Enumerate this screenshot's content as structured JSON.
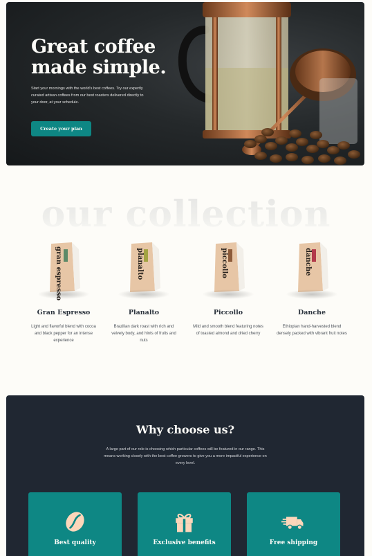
{
  "hero": {
    "title_line1": "Great coffee",
    "title_line2": "made simple.",
    "description": "Start your mornings with the world's best coffees. Try our expertly curated artisan coffees from our best roasters delivered directly to your door, at your schedule.",
    "cta_label": "Create your plan"
  },
  "collection": {
    "heading": "our collection",
    "products": [
      {
        "name": "Gran Espresso",
        "bag_label": "gran espresso",
        "accent": "#5d8a68",
        "description": "Light and flavorful blend with cocoa and black pepper for an intense experience"
      },
      {
        "name": "Planalto",
        "bag_label": "planalto",
        "accent": "#a3a342",
        "description": "Brazilian dark roast with rich and velvety body, and hints of fruits and nuts"
      },
      {
        "name": "Piccollo",
        "bag_label": "piccollo",
        "accent": "#8c5b3a",
        "description": "Mild and smooth blend featuring notes of toasted almond and dried cherry"
      },
      {
        "name": "Danche",
        "bag_label": "danche",
        "accent": "#b23a4a",
        "description": "Ethiopian hand-harvested blend densely packed with vibrant fruit notes"
      }
    ]
  },
  "why": {
    "title": "Why choose us?",
    "description": "A large part of our role is choosing which particular coffees will be featured in our range. This means working closely with the best coffee growers to give you a more impactful experience on every level.",
    "features": [
      {
        "label": "Best quality",
        "icon": "coffee-bean-icon"
      },
      {
        "label": "Exclusive benefits",
        "icon": "gift-icon"
      },
      {
        "label": "Free shipping",
        "icon": "truck-icon"
      }
    ]
  },
  "colors": {
    "accent": "#0e8784",
    "dark": "#202732",
    "background": "#fdfcf8",
    "icon": "#fdd6ba"
  }
}
